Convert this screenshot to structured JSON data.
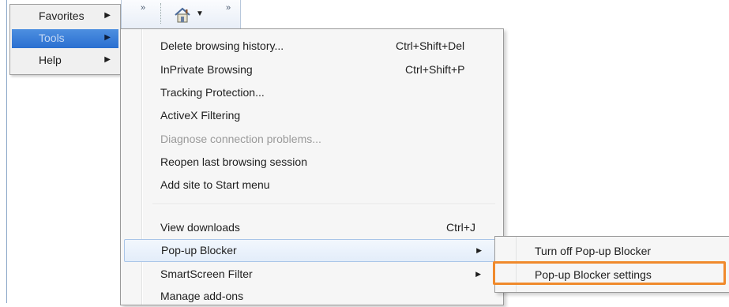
{
  "menu_bar": {
    "items": [
      {
        "label": "Favorites"
      },
      {
        "label": "Tools"
      },
      {
        "label": "Help"
      }
    ]
  },
  "toolbar": {
    "chevron_left": "»",
    "chevron_right": "»",
    "home_icon": "home-icon",
    "dropdown_icon": "caret-down-icon"
  },
  "tools_menu": {
    "items": [
      {
        "label": "Delete browsing history...",
        "shortcut": "Ctrl+Shift+Del"
      },
      {
        "label": "InPrivate Browsing",
        "shortcut": "Ctrl+Shift+P"
      },
      {
        "label": "Tracking Protection..."
      },
      {
        "label": "ActiveX Filtering"
      },
      {
        "label": "Diagnose connection problems...",
        "disabled": true
      },
      {
        "label": "Reopen last browsing session"
      },
      {
        "label": "Add site to Start menu"
      },
      {
        "label": "View downloads",
        "shortcut": "Ctrl+J"
      },
      {
        "label": "Pop-up Blocker",
        "submenu": true
      },
      {
        "label": "SmartScreen Filter",
        "submenu": true
      },
      {
        "label": "Manage add-ons"
      }
    ]
  },
  "popup_submenu": {
    "items": [
      {
        "label": "Turn off Pop-up Blocker"
      },
      {
        "label": "Pop-up Blocker settings"
      }
    ]
  },
  "colors": {
    "selection_blue": "#2a6fd0",
    "highlight_orange": "#f08a2c",
    "menu_background": "#f6f6f6"
  }
}
